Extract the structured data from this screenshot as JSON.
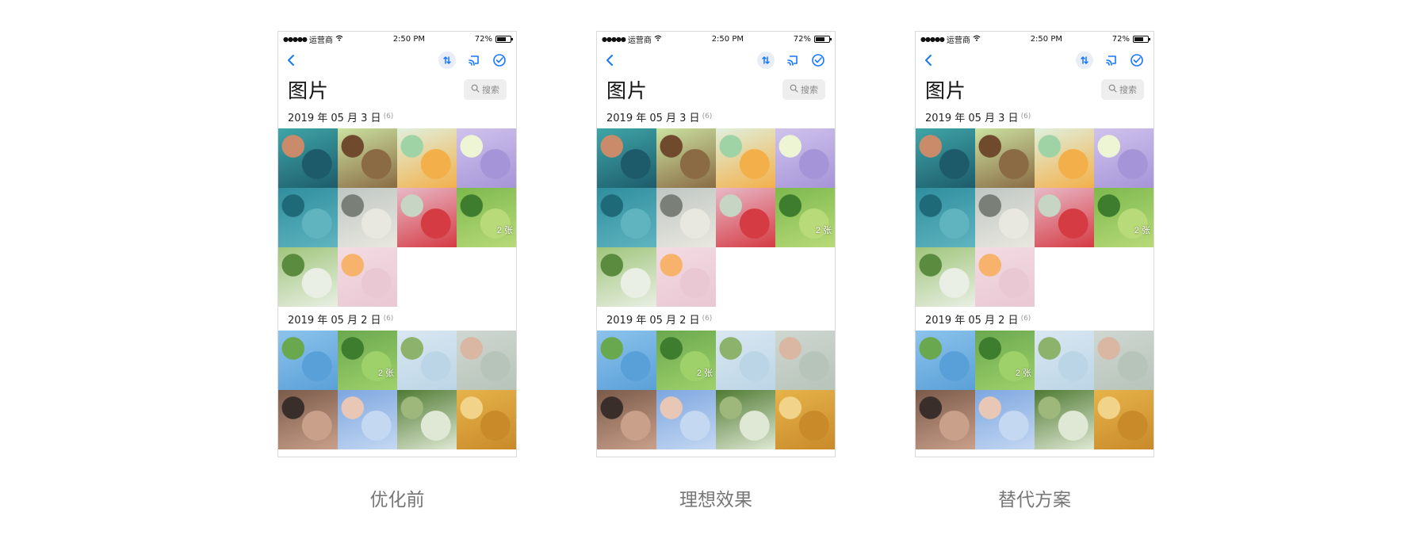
{
  "status_bar": {
    "carrier": "运营商",
    "time": "2:50 PM",
    "battery": "72%",
    "battery_level": 0.72
  },
  "header": {
    "title": "图片",
    "search_placeholder": "搜索"
  },
  "accent_color": "#1677ff",
  "icons": [
    "back-icon",
    "sort-icon",
    "cast-icon",
    "check-circle-icon",
    "search-icon",
    "wifi-icon",
    "battery-icon"
  ],
  "sections": [
    {
      "date": "2019 年 05 月 3 日",
      "count": "(6)",
      "photos": [
        {
          "colors": [
            "#3fa6a8",
            "#1d5b6b",
            "#c98b6a"
          ],
          "label": ""
        },
        {
          "colors": [
            "#cbe2a2",
            "#8a6b43",
            "#6f4a2c"
          ],
          "label": ""
        },
        {
          "colors": [
            "#dff0de",
            "#f3b04a",
            "#9fd3a5"
          ],
          "label": ""
        },
        {
          "colors": [
            "#cfc3ec",
            "#a694d8",
            "#eef5d5"
          ],
          "label": ""
        },
        {
          "colors": [
            "#2f8e9e",
            "#5fb4bf",
            "#1f6a78"
          ],
          "label": ""
        },
        {
          "colors": [
            "#bfc7c2",
            "#e9e8e0",
            "#7a7f77"
          ],
          "label": ""
        },
        {
          "colors": [
            "#e8b9c8",
            "#d53b43",
            "#c7d6c4"
          ],
          "label": ""
        },
        {
          "colors": [
            "#7cb94d",
            "#b8da78",
            "#3f7d2e"
          ],
          "label": "2 张"
        },
        {
          "colors": [
            "#9fc57a",
            "#e9efe4",
            "#5b8b3f"
          ],
          "label": ""
        },
        {
          "colors": [
            "#f3dbe2",
            "#e9c7d3",
            "#f7b26b"
          ],
          "label": ""
        }
      ]
    },
    {
      "date": "2019 年 05 月 2 日",
      "count": "(6)",
      "photos": [
        {
          "colors": [
            "#8cc3ec",
            "#5aa0d8",
            "#6aa84f"
          ],
          "label": ""
        },
        {
          "colors": [
            "#6aa84f",
            "#9fd16a",
            "#3f7d2e"
          ],
          "label": "2 张"
        },
        {
          "colors": [
            "#d9e7f2",
            "#bcd5e6",
            "#8db26b"
          ],
          "label": ""
        },
        {
          "colors": [
            "#cfd7d0",
            "#b7c4ba",
            "#d9b7a2"
          ],
          "label": ""
        },
        {
          "colors": [
            "#7a5a4a",
            "#c9a08a",
            "#3a2e2a"
          ],
          "label": ""
        },
        {
          "colors": [
            "#7da6e0",
            "#c4d8f2",
            "#e9c7b6"
          ],
          "label": ""
        },
        {
          "colors": [
            "#4f7a32",
            "#dfe8d4",
            "#9db87a"
          ],
          "label": ""
        },
        {
          "colors": [
            "#e6b34a",
            "#c98a2a",
            "#f1d48a"
          ],
          "label": ""
        }
      ]
    }
  ],
  "variants": [
    {
      "caption": "优化前"
    },
    {
      "caption": "理想效果"
    },
    {
      "caption": "替代方案"
    }
  ]
}
